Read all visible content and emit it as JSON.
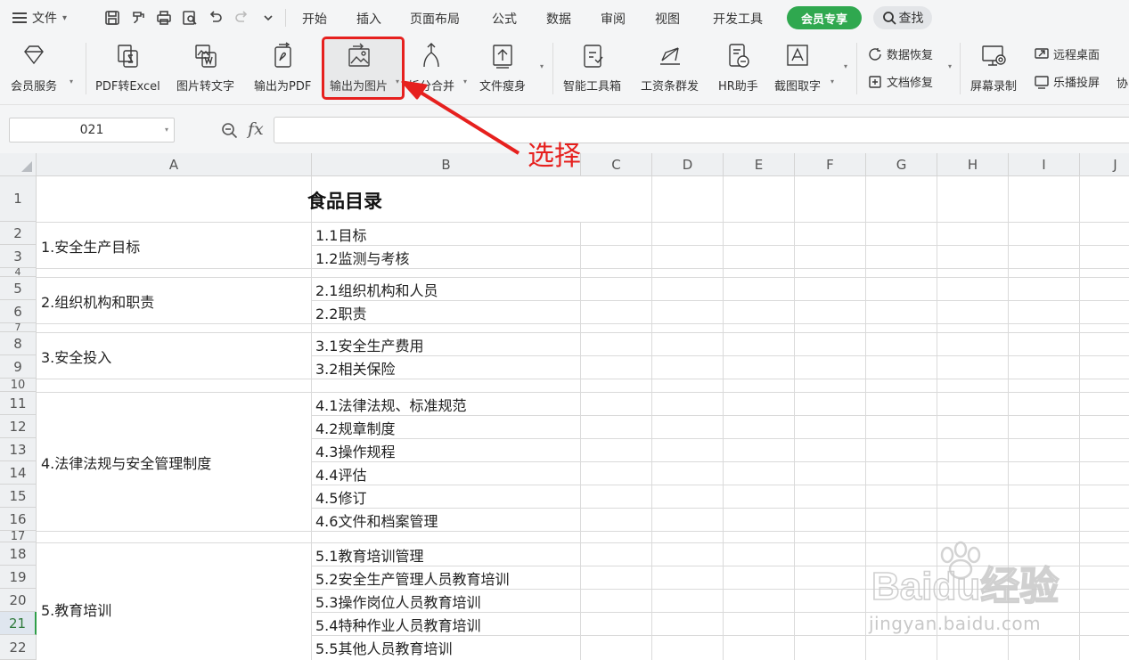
{
  "menubar": {
    "file_label": "文件",
    "tabs": [
      "开始",
      "插入",
      "页面布局",
      "公式",
      "数据",
      "审阅",
      "视图",
      "开发工具"
    ],
    "vip_label": "会员专享",
    "search_label": "查找"
  },
  "ribbon": {
    "buttons": [
      {
        "label": "会员服务",
        "icon": "diamond-icon"
      },
      {
        "label": "PDF转Excel",
        "icon": "pdf-to-excel-icon"
      },
      {
        "label": "图片转文字",
        "icon": "image-to-text-icon"
      },
      {
        "label": "输出为PDF",
        "icon": "export-pdf-icon"
      },
      {
        "label": "输出为图片",
        "icon": "export-image-icon"
      },
      {
        "label": "拆分合并",
        "icon": "split-merge-icon"
      },
      {
        "label": "文件瘦身",
        "icon": "file-slim-icon"
      },
      {
        "label": "智能工具箱",
        "icon": "toolbox-icon"
      },
      {
        "label": "工资条群发",
        "icon": "payslip-icon"
      },
      {
        "label": "HR助手",
        "icon": "hr-assistant-icon"
      },
      {
        "label": "截图取字",
        "icon": "screenshot-ocr-icon"
      }
    ],
    "small_buttons": [
      {
        "label": "数据恢复",
        "icon": "data-recovery-icon"
      },
      {
        "label": "文档修复",
        "icon": "doc-repair-icon"
      },
      {
        "label": "远程桌面",
        "icon": "remote-desktop-icon"
      },
      {
        "label": "乐播投屏",
        "icon": "cast-screen-icon"
      }
    ],
    "screen_record_label": "屏幕录制",
    "cut_label": "协"
  },
  "formula_bar": {
    "name_box": "021",
    "fx_label": "fx",
    "formula": ""
  },
  "sheet": {
    "columns": [
      "A",
      "B",
      "C",
      "D",
      "E",
      "F",
      "G",
      "H",
      "I",
      "J"
    ],
    "rows": [
      "1",
      "2",
      "3",
      "4",
      "5",
      "6",
      "7",
      "8",
      "9",
      "10",
      "11",
      "12",
      "13",
      "14",
      "15",
      "16",
      "17",
      "18",
      "19",
      "20",
      "21",
      "22"
    ],
    "active_row": "21",
    "title": "食品目录",
    "sections": [
      "1.安全生产目标",
      "2.组织机构和职责",
      "3.安全投入",
      "4.法律法规与安全管理制度",
      "5.教育培训"
    ],
    "items": [
      "1.1目标",
      "1.2监测与考核",
      "2.1组织机构和人员",
      "2.2职责",
      "3.1安全生产费用",
      "3.2相关保险",
      "4.1法律法规、标准规范",
      "4.2规章制度",
      "4.3操作规程",
      "4.4评估",
      "4.5修订",
      "4.6文件和档案管理",
      "5.1教育培训管理",
      "5.2安全生产管理人员教育培训",
      "5.3操作岗位人员教育培训",
      "5.4特种作业人员教育培训",
      "5.5其他人员教育培训"
    ]
  },
  "annotation": {
    "text": "选择",
    "color": "#e6201e"
  },
  "watermark": {
    "logo_text": "Baidu经验",
    "url": "jingyan.baidu.com"
  },
  "colors": {
    "accent_green": "#2fa84f",
    "annotation_red": "#e6201e",
    "header_bg": "#eef0f2",
    "ribbon_bg": "#f4f5f6"
  }
}
